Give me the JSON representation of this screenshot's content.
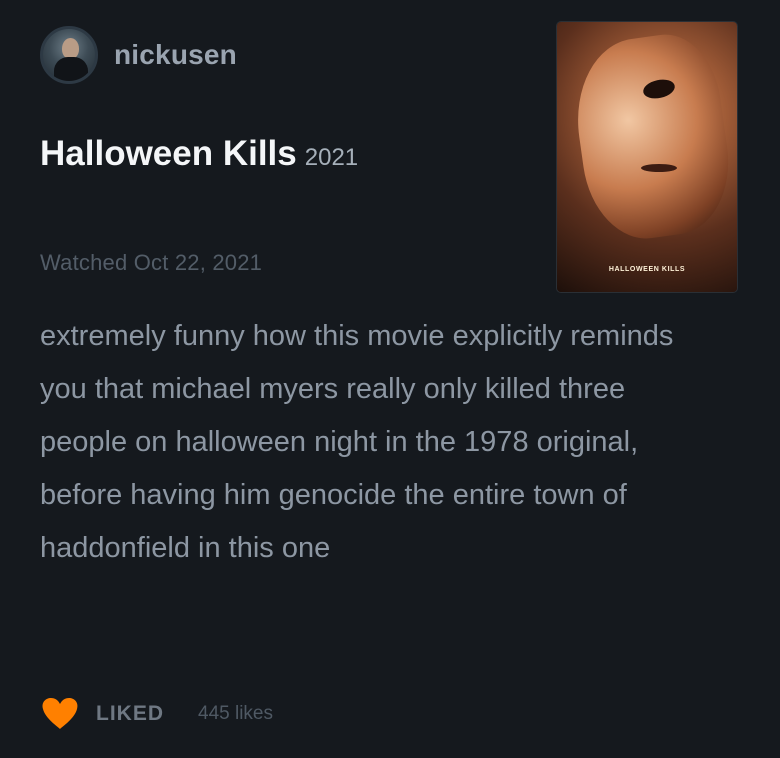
{
  "user": {
    "username": "nickusen"
  },
  "film": {
    "title": "Halloween Kills",
    "year": "2021",
    "poster_title": "HALLOWEEN KILLS"
  },
  "entry": {
    "watched": "Watched Oct 22, 2021",
    "review": "extremely funny how this movie explicitly reminds you that michael myers really only killed three people on halloween night in the 1978 original, before having him genocide the entire town of haddonfield in this one"
  },
  "footer": {
    "liked_label": "LIKED",
    "likes_count": "445 likes"
  },
  "colors": {
    "background": "#15191e",
    "heart": "#ff8000"
  },
  "icons": {
    "heart": "heart-icon",
    "avatar": "user-avatar"
  }
}
